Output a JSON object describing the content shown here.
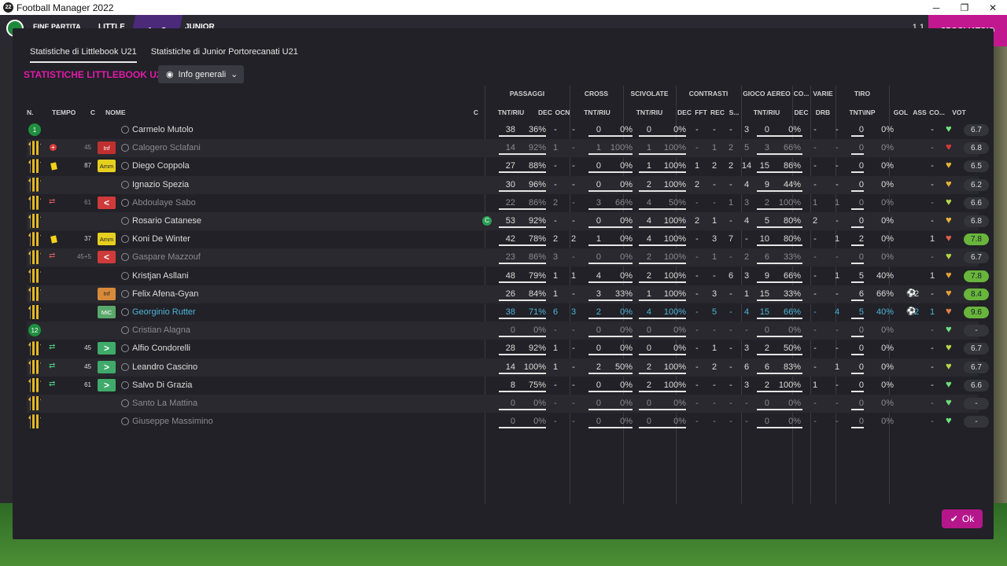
{
  "window": {
    "title": "Football Manager 2022",
    "app_icon": "22",
    "min": "─",
    "max": "❐",
    "close": "✕"
  },
  "background": {
    "end_match": "FINE PARTITA",
    "home_short": "LITTLE",
    "score": "4 - 3",
    "away_short": "JUNIOR",
    "right_text": "1 1",
    "right_button": "SPOGLIATOIO"
  },
  "tabs": [
    "Statistiche di Littlebook U21",
    "Statistiche di Junior Portorecanati U21"
  ],
  "section_title": "STATISTICHE LITTLEBOOK U21",
  "view_dropdown": {
    "label": "Info generali"
  },
  "groups": {
    "passaggi": "PASSAGGI",
    "cross": "CROSS",
    "scivolate": "SCIVOLATE",
    "contrasti": "CONTRASTI",
    "aereo": "GIOCO AEREO",
    "co": "CO...",
    "varie": "VARIE",
    "tiro": "TIRO"
  },
  "columns": {
    "n": "N.",
    "tempo": "TEMPO",
    "c": "C",
    "nome": "NOME",
    "c2": "C",
    "pass": "TNT/RIU",
    "dec": "DEC",
    "ocn": "OCN",
    "cross": "TNT/RIU",
    "sciv": "TNT/RIU",
    "cdec": "DEC",
    "fft": "FFT",
    "rec": "REC",
    "s": "S...",
    "aereo": "TNT/RIU",
    "codec": "DEC",
    "drb": "DRB",
    "tiro": "TNT\\INP",
    "gol": "GOL",
    "ass": "ASS",
    "cond": "CO...",
    "vot": "VOT"
  },
  "rows": [
    {
      "n": "1",
      "tempo": "",
      "c": "",
      "name": "Carmelo Mutolo",
      "cap": "",
      "pt": "38",
      "pp": "36%",
      "dec": "-",
      "ocn": "-",
      "ct": "0",
      "cp": "0%",
      "st": "0",
      "sp": "0%",
      "cd": "-",
      "fft": "-",
      "rec": "-",
      "s": "3",
      "at": "0",
      "ap": "0%",
      "co": "-",
      "drb": "-",
      "tt": "0",
      "tp": "0%",
      "gol": "",
      "ass": "-",
      "vot": "6.7"
    },
    {
      "n": "",
      "tempo": "45",
      "c": "Inf",
      "name": "Calogero Sclafani",
      "cap": "",
      "pt": "14",
      "pp": "92%",
      "dec": "1",
      "ocn": "-",
      "ct": "1",
      "cp": "100%",
      "st": "1",
      "sp": "100%",
      "cd": "-",
      "fft": "1",
      "rec": "2",
      "s": "5",
      "at": "3",
      "ap": "66%",
      "co": "-",
      "drb": "-",
      "tt": "0",
      "tp": "0%",
      "gol": "",
      "ass": "-",
      "vot": "6.8"
    },
    {
      "n": "",
      "tempo": "87",
      "c": "Amm",
      "name": "Diego Coppola",
      "cap": "",
      "pt": "27",
      "pp": "88%",
      "dec": "-",
      "ocn": "-",
      "ct": "0",
      "cp": "0%",
      "st": "1",
      "sp": "100%",
      "cd": "1",
      "fft": "2",
      "rec": "2",
      "s": "14",
      "at": "15",
      "ap": "86%",
      "co": "-",
      "drb": "-",
      "tt": "0",
      "tp": "0%",
      "gol": "",
      "ass": "-",
      "vot": "6.5"
    },
    {
      "n": "",
      "tempo": "",
      "c": "",
      "name": "Ignazio Spezia",
      "cap": "",
      "pt": "30",
      "pp": "96%",
      "dec": "-",
      "ocn": "-",
      "ct": "0",
      "cp": "0%",
      "st": "2",
      "sp": "100%",
      "cd": "2",
      "fft": "-",
      "rec": "-",
      "s": "4",
      "at": "9",
      "ap": "44%",
      "co": "-",
      "drb": "-",
      "tt": "0",
      "tp": "0%",
      "gol": "",
      "ass": "-",
      "vot": "6.2"
    },
    {
      "n": "",
      "tempo": "61",
      "c": "<",
      "name": "Abdoulaye Sabo",
      "cap": "",
      "pt": "22",
      "pp": "86%",
      "dec": "2",
      "ocn": "-",
      "ct": "3",
      "cp": "66%",
      "st": "4",
      "sp": "50%",
      "cd": "-",
      "fft": "-",
      "rec": "1",
      "s": "3",
      "at": "2",
      "ap": "100%",
      "co": "1",
      "drb": "1",
      "tt": "0",
      "tp": "0%",
      "gol": "",
      "ass": "-",
      "vot": "6.6"
    },
    {
      "n": "",
      "tempo": "",
      "c": "",
      "name": "Rosario Catanese",
      "cap": "C",
      "pt": "53",
      "pp": "92%",
      "dec": "-",
      "ocn": "-",
      "ct": "0",
      "cp": "0%",
      "st": "4",
      "sp": "100%",
      "cd": "2",
      "fft": "1",
      "rec": "-",
      "s": "4",
      "at": "5",
      "ap": "80%",
      "co": "2",
      "drb": "-",
      "tt": "0",
      "tp": "0%",
      "gol": "",
      "ass": "-",
      "vot": "6.8"
    },
    {
      "n": "",
      "tempo": "37",
      "c": "Amm",
      "name": "Koni De Winter",
      "cap": "",
      "pt": "42",
      "pp": "78%",
      "dec": "2",
      "ocn": "2",
      "ct": "1",
      "cp": "0%",
      "st": "4",
      "sp": "100%",
      "cd": "-",
      "fft": "3",
      "rec": "7",
      "s": "-",
      "at": "10",
      "ap": "80%",
      "co": "-",
      "drb": "1",
      "tt": "2",
      "tp": "0%",
      "gol": "",
      "ass": "1",
      "vot": "7.8"
    },
    {
      "n": "",
      "tempo": "45+5",
      "c": "<",
      "name": "Gaspare Mazzouf",
      "cap": "",
      "pt": "23",
      "pp": "86%",
      "dec": "3",
      "ocn": "-",
      "ct": "0",
      "cp": "0%",
      "st": "2",
      "sp": "100%",
      "cd": "-",
      "fft": "1",
      "rec": "-",
      "s": "2",
      "at": "6",
      "ap": "33%",
      "co": "-",
      "drb": "-",
      "tt": "0",
      "tp": "0%",
      "gol": "",
      "ass": "-",
      "vot": "6.7"
    },
    {
      "n": "",
      "tempo": "",
      "c": "",
      "name": "Kristjan Asllani",
      "cap": "",
      "pt": "48",
      "pp": "79%",
      "dec": "1",
      "ocn": "1",
      "ct": "4",
      "cp": "0%",
      "st": "2",
      "sp": "100%",
      "cd": "-",
      "fft": "-",
      "rec": "6",
      "s": "3",
      "at": "9",
      "ap": "66%",
      "co": "-",
      "drb": "1",
      "tt": "5",
      "tp": "40%",
      "gol": "",
      "ass": "1",
      "vot": "7.8"
    },
    {
      "n": "",
      "tempo": "",
      "c": "Inf",
      "name": "Felix Afena-Gyan",
      "cap": "",
      "pt": "26",
      "pp": "84%",
      "dec": "1",
      "ocn": "-",
      "ct": "3",
      "cp": "33%",
      "st": "1",
      "sp": "100%",
      "cd": "-",
      "fft": "3",
      "rec": "-",
      "s": "1",
      "at": "15",
      "ap": "33%",
      "co": "-",
      "drb": "-",
      "tt": "6",
      "tp": "66%",
      "gol": "2",
      "ass": "-",
      "vot": "8.4"
    },
    {
      "n": "",
      "tempo": "",
      "c": "MiC",
      "name": "Georginio Rutter",
      "cap": "",
      "pt": "38",
      "pp": "71%",
      "dec": "6",
      "ocn": "3",
      "ct": "2",
      "cp": "0%",
      "st": "4",
      "sp": "100%",
      "cd": "-",
      "fft": "5",
      "rec": "-",
      "s": "4",
      "at": "15",
      "ap": "66%",
      "co": "-",
      "drb": "4",
      "tt": "5",
      "tp": "40%",
      "gol": "2",
      "ass": "1",
      "vot": "9.6"
    },
    {
      "n": "12",
      "tempo": "",
      "c": "",
      "name": "Cristian Alagna",
      "cap": "",
      "pt": "0",
      "pp": "0%",
      "dec": "-",
      "ocn": "-",
      "ct": "0",
      "cp": "0%",
      "st": "0",
      "sp": "0%",
      "cd": "-",
      "fft": "-",
      "rec": "-",
      "s": "-",
      "at": "0",
      "ap": "0%",
      "co": "-",
      "drb": "-",
      "tt": "0",
      "tp": "0%",
      "gol": "",
      "ass": "-",
      "vot": "-"
    },
    {
      "n": "",
      "tempo": "45",
      "c": ">",
      "name": "Alfio Condorelli",
      "cap": "",
      "pt": "28",
      "pp": "92%",
      "dec": "1",
      "ocn": "-",
      "ct": "0",
      "cp": "0%",
      "st": "0",
      "sp": "0%",
      "cd": "-",
      "fft": "1",
      "rec": "-",
      "s": "3",
      "at": "2",
      "ap": "50%",
      "co": "-",
      "drb": "-",
      "tt": "0",
      "tp": "0%",
      "gol": "",
      "ass": "-",
      "vot": "6.7"
    },
    {
      "n": "",
      "tempo": "45",
      "c": ">",
      "name": "Leandro Cascino",
      "cap": "",
      "pt": "14",
      "pp": "100%",
      "dec": "1",
      "ocn": "-",
      "ct": "2",
      "cp": "50%",
      "st": "2",
      "sp": "100%",
      "cd": "-",
      "fft": "2",
      "rec": "-",
      "s": "6",
      "at": "6",
      "ap": "83%",
      "co": "-",
      "drb": "1",
      "tt": "0",
      "tp": "0%",
      "gol": "",
      "ass": "-",
      "vot": "6.7"
    },
    {
      "n": "",
      "tempo": "61",
      "c": ">",
      "name": "Salvo Di Grazia",
      "cap": "",
      "pt": "8",
      "pp": "75%",
      "dec": "-",
      "ocn": "-",
      "ct": "0",
      "cp": "0%",
      "st": "2",
      "sp": "100%",
      "cd": "-",
      "fft": "-",
      "rec": "-",
      "s": "3",
      "at": "2",
      "ap": "100%",
      "co": "1",
      "drb": "-",
      "tt": "0",
      "tp": "0%",
      "gol": "",
      "ass": "-",
      "vot": "6.6"
    },
    {
      "n": "",
      "tempo": "",
      "c": "",
      "name": "Santo La Mattina",
      "cap": "",
      "pt": "0",
      "pp": "0%",
      "dec": "-",
      "ocn": "-",
      "ct": "0",
      "cp": "0%",
      "st": "0",
      "sp": "0%",
      "cd": "-",
      "fft": "-",
      "rec": "-",
      "s": "-",
      "at": "0",
      "ap": "0%",
      "co": "-",
      "drb": "-",
      "tt": "0",
      "tp": "0%",
      "gol": "",
      "ass": "-",
      "vot": "-"
    },
    {
      "n": "",
      "tempo": "",
      "c": "",
      "name": "Giuseppe Massimino",
      "cap": "",
      "pt": "0",
      "pp": "0%",
      "dec": "-",
      "ocn": "-",
      "ct": "0",
      "cp": "0%",
      "st": "0",
      "sp": "0%",
      "cd": "-",
      "fft": "-",
      "rec": "-",
      "s": "-",
      "at": "0",
      "ap": "0%",
      "co": "-",
      "drb": "-",
      "tt": "0",
      "tp": "0%",
      "gol": "",
      "ass": "-",
      "vot": "-"
    }
  ],
  "ok_button": "Ok"
}
